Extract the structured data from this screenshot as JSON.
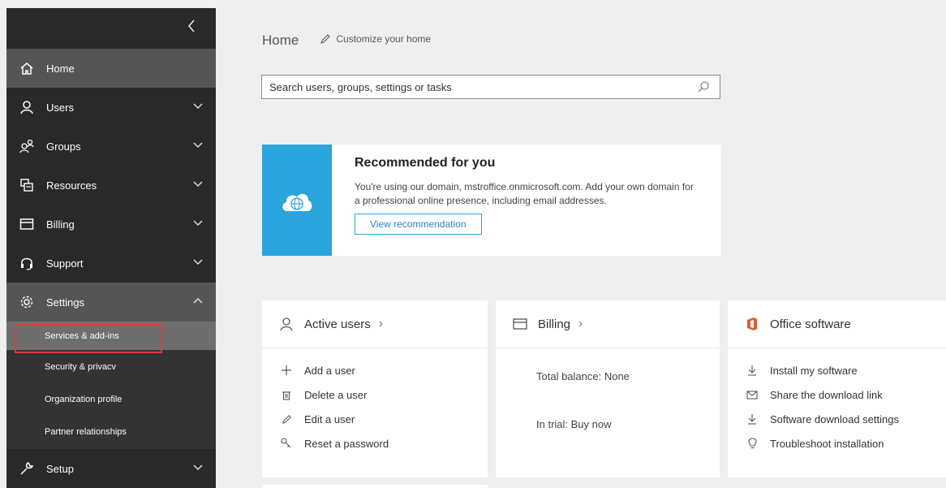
{
  "sidebar": {
    "items": [
      {
        "label": "Home",
        "icon": "home-icon",
        "state": "active"
      },
      {
        "label": "Users",
        "icon": "user-icon",
        "state": "collapsed"
      },
      {
        "label": "Groups",
        "icon": "group-icon",
        "state": "collapsed"
      },
      {
        "label": "Resources",
        "icon": "resources-icon",
        "state": "collapsed"
      },
      {
        "label": "Billing",
        "icon": "billing-icon",
        "state": "collapsed"
      },
      {
        "label": "Support",
        "icon": "headset-icon",
        "state": "collapsed"
      },
      {
        "label": "Settings",
        "icon": "gear-icon",
        "state": "expanded"
      },
      {
        "label": "Setup",
        "icon": "wrench-icon",
        "state": "collapsed"
      }
    ],
    "settings_subitems": [
      {
        "label": "Services & add-ins",
        "selected": true
      },
      {
        "label": "Security & privacv"
      },
      {
        "label": "Organization profile"
      },
      {
        "label": "Partner relationships"
      }
    ]
  },
  "header": {
    "title": "Home",
    "customize_label": "Customize your home"
  },
  "search": {
    "placeholder": "Search users, groups, settings or tasks"
  },
  "recommendation": {
    "title": "Recommended for you",
    "text": "You're using our domain, mstroffice.onmicrosoft.com. Add your own domain for a professional online presence, including email addresses.",
    "button_label": "View recommendation"
  },
  "tiles": {
    "active_users": {
      "title": "Active users",
      "actions": [
        "Add a user",
        "Delete a user",
        "Edit a user",
        "Reset a password"
      ]
    },
    "billing": {
      "title": "Billing",
      "total_balance": "Total balance: None",
      "trial": "In trial: Buy now"
    },
    "office_software": {
      "title": "Office software",
      "actions": [
        "Install my software",
        "Share the download link",
        "Software download settings",
        "Troubleshoot installation"
      ]
    }
  },
  "colors": {
    "sidebar_bg": "#292929",
    "sidebar_active": "#555555",
    "accent_blue": "#2aa4dc",
    "office_orange": "#e8582a",
    "highlight_red": "#e03b3b"
  }
}
